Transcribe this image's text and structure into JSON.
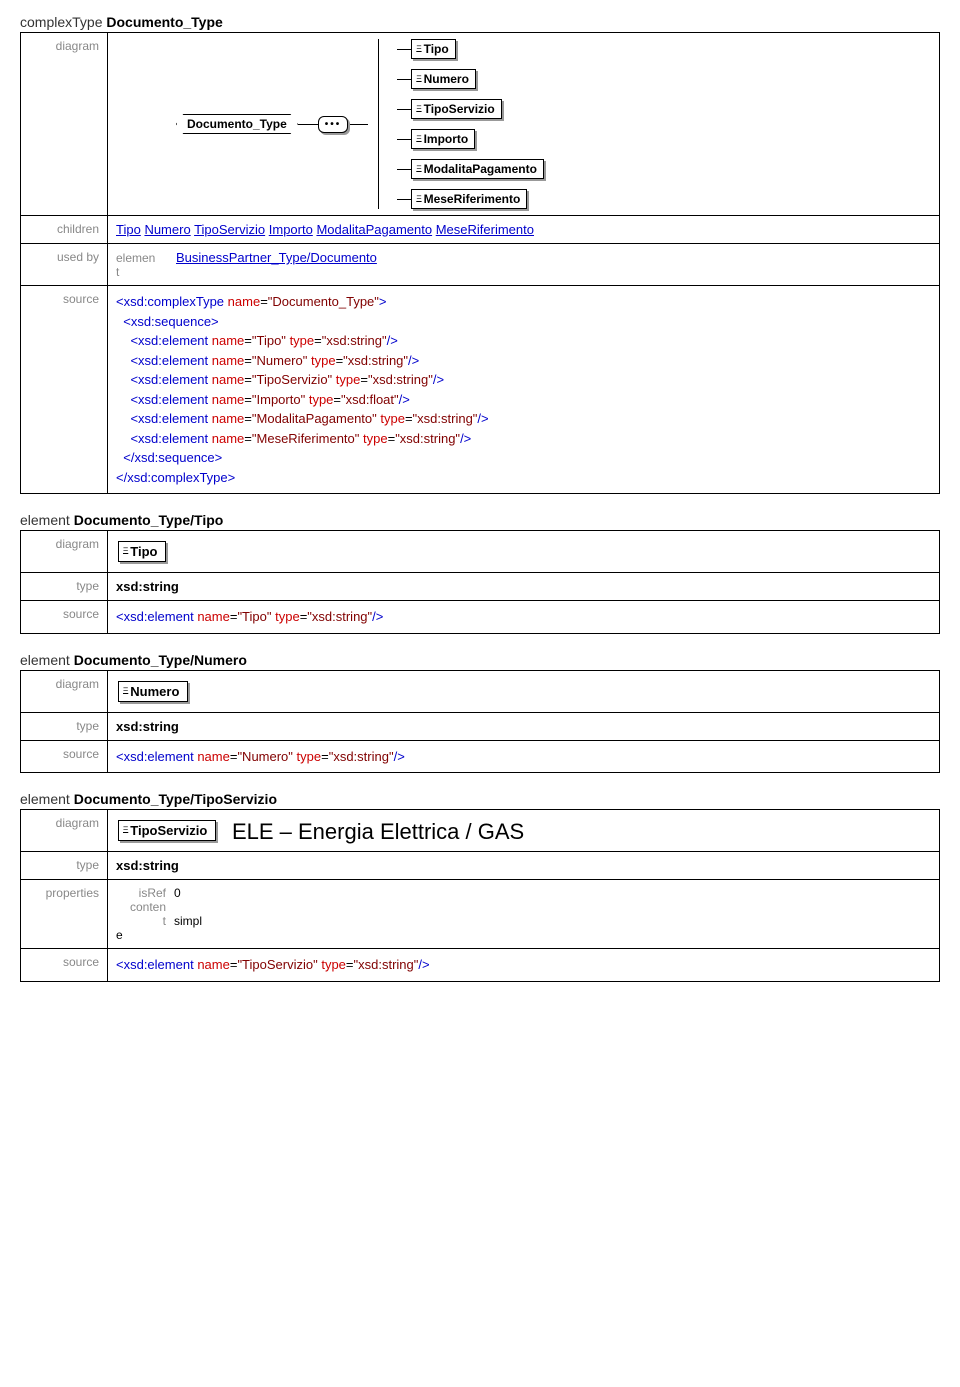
{
  "mainType": {
    "prefix": "complexType",
    "name": "Documento_Type",
    "diagram": {
      "root": "Documento_Type",
      "children": [
        "Tipo",
        "Numero",
        "TipoServizio",
        "Importo",
        "ModalitaPagamento",
        "MeseRiferimento"
      ]
    },
    "labels": {
      "diagram": "diagram",
      "children": "children",
      "usedby": "used by",
      "source": "source"
    },
    "childrenLinks": [
      "Tipo",
      "Numero",
      "TipoServizio",
      "Importo",
      "ModalitaPagamento",
      "MeseRiferimento"
    ],
    "usedBy": {
      "kind": "elemen\nt",
      "link": "BusinessPartner_Type/Documento"
    },
    "source": [
      {
        "i": 0,
        "parts": [
          {
            "c": "tag",
            "t": "<xsd:complexType"
          },
          {
            "c": "",
            "t": " "
          },
          {
            "c": "attr",
            "t": "name"
          },
          {
            "c": "",
            "t": "="
          },
          {
            "c": "val",
            "t": "\"Documento_Type\""
          },
          {
            "c": "tag",
            "t": ">"
          }
        ]
      },
      {
        "i": 1,
        "parts": [
          {
            "c": "tag",
            "t": "<xsd:sequence>"
          }
        ]
      },
      {
        "i": 2,
        "parts": [
          {
            "c": "tag",
            "t": "<xsd:element"
          },
          {
            "c": "",
            "t": " "
          },
          {
            "c": "attr",
            "t": "name"
          },
          {
            "c": "",
            "t": "="
          },
          {
            "c": "val",
            "t": "\"Tipo\""
          },
          {
            "c": "",
            "t": " "
          },
          {
            "c": "attr",
            "t": "type"
          },
          {
            "c": "",
            "t": "="
          },
          {
            "c": "val",
            "t": "\"xsd:string\""
          },
          {
            "c": "tag",
            "t": "/>"
          }
        ]
      },
      {
        "i": 2,
        "parts": [
          {
            "c": "tag",
            "t": "<xsd:element"
          },
          {
            "c": "",
            "t": " "
          },
          {
            "c": "attr",
            "t": "name"
          },
          {
            "c": "",
            "t": "="
          },
          {
            "c": "val",
            "t": "\"Numero\""
          },
          {
            "c": "",
            "t": " "
          },
          {
            "c": "attr",
            "t": "type"
          },
          {
            "c": "",
            "t": "="
          },
          {
            "c": "val",
            "t": "\"xsd:string\""
          },
          {
            "c": "tag",
            "t": "/>"
          }
        ]
      },
      {
        "i": 2,
        "parts": [
          {
            "c": "tag",
            "t": "<xsd:element"
          },
          {
            "c": "",
            "t": " "
          },
          {
            "c": "attr",
            "t": "name"
          },
          {
            "c": "",
            "t": "="
          },
          {
            "c": "val",
            "t": "\"TipoServizio\""
          },
          {
            "c": "",
            "t": " "
          },
          {
            "c": "attr",
            "t": "type"
          },
          {
            "c": "",
            "t": "="
          },
          {
            "c": "val",
            "t": "\"xsd:string\""
          },
          {
            "c": "tag",
            "t": "/>"
          }
        ]
      },
      {
        "i": 2,
        "parts": [
          {
            "c": "tag",
            "t": "<xsd:element"
          },
          {
            "c": "",
            "t": " "
          },
          {
            "c": "attr",
            "t": "name"
          },
          {
            "c": "",
            "t": "="
          },
          {
            "c": "val",
            "t": "\"Importo\""
          },
          {
            "c": "",
            "t": " "
          },
          {
            "c": "attr",
            "t": "type"
          },
          {
            "c": "",
            "t": "="
          },
          {
            "c": "val",
            "t": "\"xsd:float\""
          },
          {
            "c": "tag",
            "t": "/>"
          }
        ]
      },
      {
        "i": 2,
        "parts": [
          {
            "c": "tag",
            "t": "<xsd:element"
          },
          {
            "c": "",
            "t": " "
          },
          {
            "c": "attr",
            "t": "name"
          },
          {
            "c": "",
            "t": "="
          },
          {
            "c": "val",
            "t": "\"ModalitaPagamento\""
          },
          {
            "c": "",
            "t": " "
          },
          {
            "c": "attr",
            "t": "type"
          },
          {
            "c": "",
            "t": "="
          },
          {
            "c": "val",
            "t": "\"xsd:string\""
          },
          {
            "c": "tag",
            "t": "/>"
          }
        ]
      },
      {
        "i": 2,
        "parts": [
          {
            "c": "tag",
            "t": "<xsd:element"
          },
          {
            "c": "",
            "t": " "
          },
          {
            "c": "attr",
            "t": "name"
          },
          {
            "c": "",
            "t": "="
          },
          {
            "c": "val",
            "t": "\"MeseRiferimento\""
          },
          {
            "c": "",
            "t": " "
          },
          {
            "c": "attr",
            "t": "type"
          },
          {
            "c": "",
            "t": "="
          },
          {
            "c": "val",
            "t": "\"xsd:string\""
          },
          {
            "c": "tag",
            "t": "/>"
          }
        ]
      },
      {
        "i": 1,
        "parts": [
          {
            "c": "tag",
            "t": "</xsd:sequence>"
          }
        ]
      },
      {
        "i": 0,
        "parts": [
          {
            "c": "tag",
            "t": "</xsd:complexType>"
          }
        ]
      }
    ]
  },
  "elements": [
    {
      "title": {
        "prefix": "element",
        "name": "Documento_Type/Tipo"
      },
      "nodeLabel": "Tipo",
      "type": "xsd:string",
      "source": [
        {
          "i": 0,
          "parts": [
            {
              "c": "tag",
              "t": "<xsd:element"
            },
            {
              "c": "",
              "t": " "
            },
            {
              "c": "attr",
              "t": "name"
            },
            {
              "c": "",
              "t": "="
            },
            {
              "c": "val",
              "t": "\"Tipo\""
            },
            {
              "c": "",
              "t": " "
            },
            {
              "c": "attr",
              "t": "type"
            },
            {
              "c": "",
              "t": "="
            },
            {
              "c": "val",
              "t": "\"xsd:string\""
            },
            {
              "c": "tag",
              "t": "/>"
            }
          ]
        }
      ]
    },
    {
      "title": {
        "prefix": "element",
        "name": "Documento_Type/Numero"
      },
      "nodeLabel": "Numero",
      "type": "xsd:string",
      "source": [
        {
          "i": 0,
          "parts": [
            {
              "c": "tag",
              "t": "<xsd:element"
            },
            {
              "c": "",
              "t": " "
            },
            {
              "c": "attr",
              "t": "name"
            },
            {
              "c": "",
              "t": "="
            },
            {
              "c": "val",
              "t": "\"Numero\""
            },
            {
              "c": "",
              "t": " "
            },
            {
              "c": "attr",
              "t": "type"
            },
            {
              "c": "",
              "t": "="
            },
            {
              "c": "val",
              "t": "\"xsd:string\""
            },
            {
              "c": "tag",
              "t": "/>"
            }
          ]
        }
      ]
    }
  ],
  "tipoServizio": {
    "title": {
      "prefix": "element",
      "name": "Documento_Type/TipoServizio"
    },
    "nodeLabel": "TipoServizio",
    "note": "ELE – Energia Elettrica / GAS",
    "type": "xsd:string",
    "props": [
      {
        "k": "isRef",
        "v": "0"
      },
      {
        "k": "conten\nt",
        "v": "simpl\ne"
      }
    ],
    "source": [
      {
        "i": 0,
        "parts": [
          {
            "c": "tag",
            "t": "<xsd:element"
          },
          {
            "c": "",
            "t": " "
          },
          {
            "c": "attr",
            "t": "name"
          },
          {
            "c": "",
            "t": "="
          },
          {
            "c": "val",
            "t": "\"TipoServizio\""
          },
          {
            "c": "",
            "t": " "
          },
          {
            "c": "attr",
            "t": "type"
          },
          {
            "c": "",
            "t": "="
          },
          {
            "c": "val",
            "t": "\"xsd:string\""
          },
          {
            "c": "tag",
            "t": "/>"
          }
        ]
      }
    ]
  },
  "rowLabels": {
    "diagram": "diagram",
    "type": "type",
    "source": "source",
    "properties": "properties"
  }
}
